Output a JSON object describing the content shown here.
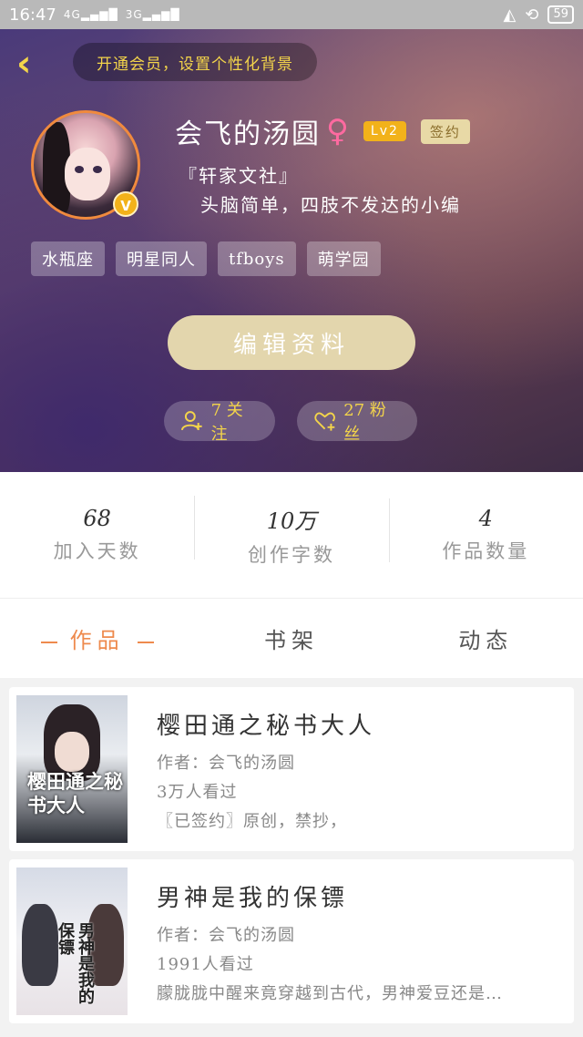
{
  "status_bar": {
    "time": "16:47",
    "signal1": "4G",
    "signal2": "3G",
    "battery": "59"
  },
  "header": {
    "vip_prompt": "开通会员，设置个性化背景",
    "username": "会飞的汤圆",
    "gender_symbol": "♀",
    "level": "Lv2",
    "contract_badge": "签约",
    "avatar_badge": "V",
    "bio_line1": "『轩家文社』",
    "bio_line2": "头脑简单，四肢不发达的小编",
    "tags": [
      "水瓶座",
      "明星同人",
      "tfboys",
      "萌学园"
    ],
    "edit_label": "编辑资料",
    "following": "7 关注",
    "fans": "27 粉丝"
  },
  "stats": [
    {
      "num": "68",
      "label": "加入天数"
    },
    {
      "num": "10万",
      "label": "创作字数"
    },
    {
      "num": "4",
      "label": "作品数量"
    }
  ],
  "tabs": [
    "作品",
    "书架",
    "动态"
  ],
  "books": [
    {
      "title": "樱田通之秘书大人",
      "author": "作者：会飞的汤圆",
      "views": "3万人看过",
      "desc": "〖已签约〗原创，禁抄，",
      "cover_text": "樱田通之秘书大人"
    },
    {
      "title": "男神是我的保镖",
      "author": "作者：会飞的汤圆",
      "views": "1991人看过",
      "desc": "朦胧胧中醒来竟穿越到古代，男神爱豆还是…",
      "cover_text": "男神是我的保镖"
    }
  ]
}
